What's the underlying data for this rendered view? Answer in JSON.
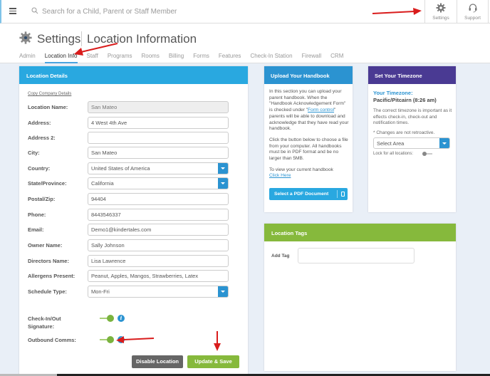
{
  "topbar": {
    "search_placeholder": "Search for a Child, Parent or Staff Member",
    "settings_label": "Settings",
    "support_label": "Support"
  },
  "header": {
    "title": "Settings",
    "subtitle": "Location Information",
    "tabs": [
      {
        "label": "Admin",
        "active": false
      },
      {
        "label": "Location Info",
        "active": true
      },
      {
        "label": "Staff",
        "active": false
      },
      {
        "label": "Programs",
        "active": false
      },
      {
        "label": "Rooms",
        "active": false
      },
      {
        "label": "Billing",
        "active": false
      },
      {
        "label": "Forms",
        "active": false
      },
      {
        "label": "Features",
        "active": false
      },
      {
        "label": "Check-In Station",
        "active": false
      },
      {
        "label": "Firewall",
        "active": false
      },
      {
        "label": "CRM",
        "active": false
      }
    ]
  },
  "location_details": {
    "title": "Location Details",
    "copy_link": "Copy Company Details",
    "fields": {
      "location_name": {
        "label": "Location Name:",
        "value": "San Mateo"
      },
      "address": {
        "label": "Address:",
        "value": "4 West 4th Ave"
      },
      "address2": {
        "label": "Address 2:",
        "value": ""
      },
      "city": {
        "label": "City:",
        "value": "San Mateo"
      },
      "country": {
        "label": "Country:",
        "value": "United States of America"
      },
      "state": {
        "label": "State/Province:",
        "value": "California"
      },
      "postal": {
        "label": "Postal/Zip:",
        "value": "94404"
      },
      "phone": {
        "label": "Phone:",
        "value": "8443546337"
      },
      "email": {
        "label": "Email:",
        "value": "Demo1@kindertales.com"
      },
      "owner": {
        "label": "Owner Name:",
        "value": "Sally Johnson"
      },
      "directors": {
        "label": "Directors Name:",
        "value": "Lisa Lawrence"
      },
      "allergens": {
        "label": "Allergens Present:",
        "value": "Peanut, Apples, Mangos, Strawberries, Latex"
      },
      "schedule": {
        "label": "Schedule Type:",
        "value": "Mon-Fri"
      }
    },
    "checkin_signature": {
      "label_line1": "Check-In/Out",
      "label_line2": "Signature:",
      "enabled": true
    },
    "outbound_comms": {
      "label": "Outbound Comms:",
      "enabled": true
    },
    "disable_button": "Disable Location",
    "save_button": "Update & Save"
  },
  "handbook": {
    "title": "Upload Your Handbook",
    "para1_a": "In this section you can upload your parent handbook. When the \"Handbook Acknowledgement Form\" is checked under \"",
    "para1_link": "Form control",
    "para1_b": "\" parents will be able to download and acknowledge that they have read your handbook.",
    "para2": "Click the button below to choose a file from your computer. All handbooks must be in PDF format and be no larger than 5MB.",
    "para3": "To view your current handbook",
    "click_here": "Click Here",
    "select_button": "Select a PDF Document"
  },
  "timezone": {
    "title": "Set Your Timezone",
    "label": "Your Timezone:",
    "value": "Pacific/Pitcairn (8:26 am)",
    "description": "The correct timezone is important as it effects check-in, check-out and notification times.",
    "note": "* Changes are not retroactive.",
    "select_placeholder": "Select Area",
    "lock_label": "Lock for all locations:",
    "lock_enabled": false
  },
  "tags": {
    "title": "Location Tags",
    "add_label": "Add Tag",
    "input_value": ""
  },
  "colors": {
    "primary_blue": "#29a8e0",
    "handbook_blue": "#2b93d1",
    "timezone_purple": "#4a3a93",
    "tags_green": "#86b93c",
    "disable_gray": "#666666",
    "annotation_red": "#d91c1c"
  }
}
